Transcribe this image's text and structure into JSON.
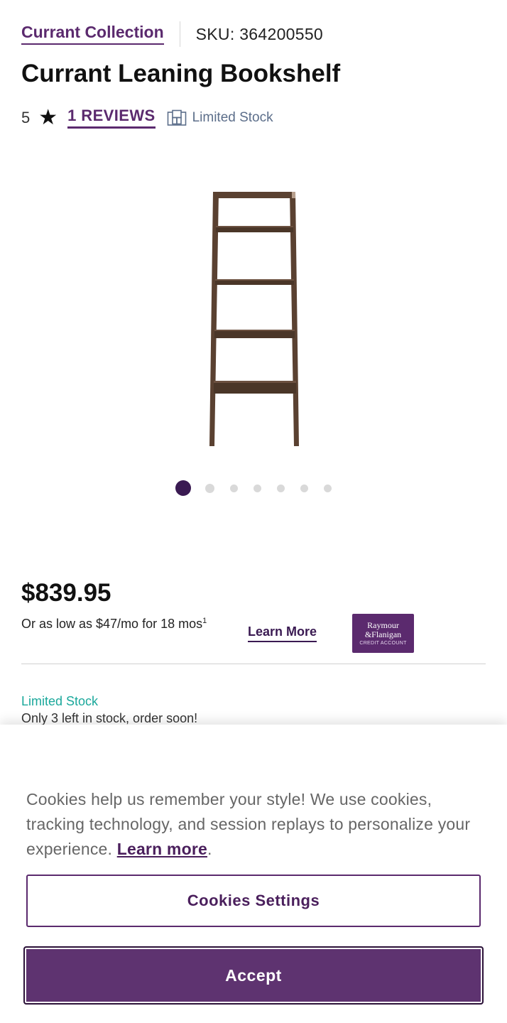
{
  "header": {
    "collection_link": "Currant Collection",
    "sku": "SKU: 364200550"
  },
  "product": {
    "title": "Currant Leaning Bookshelf",
    "rating": "5",
    "reviews_link": "1 REVIEWS",
    "stock_badge": "Limited Stock",
    "image_icon": "leaning-ladder-bookshelf-image"
  },
  "carousel": {
    "total_slides": 7,
    "active_index": 0
  },
  "pricing": {
    "price": "$839.95",
    "finance_text": "Or as low as $47/mo for 18 mos",
    "finance_footnote": "1",
    "learn_more": "Learn More",
    "credit_logo": {
      "line1": "Raymour",
      "line2": "&Flanigan",
      "line3": "CREDIT ACCOUNT"
    }
  },
  "availability": {
    "status": "Limited Stock",
    "message": "Only 3 left in stock, order soon!"
  },
  "cookie_banner": {
    "text": "Cookies help us remember your style! We use cookies, tracking technology, and session replays to personalize your experience.",
    "learn_more": "Learn more",
    "trailing": ".",
    "settings_button": "Cookies Settings",
    "accept_button": "Accept"
  },
  "colors": {
    "brand_purple": "#5b2a6e",
    "accept_purple": "#5e3370",
    "limited_stock_teal": "#1aa89b",
    "active_dot": "#3a1a52"
  }
}
